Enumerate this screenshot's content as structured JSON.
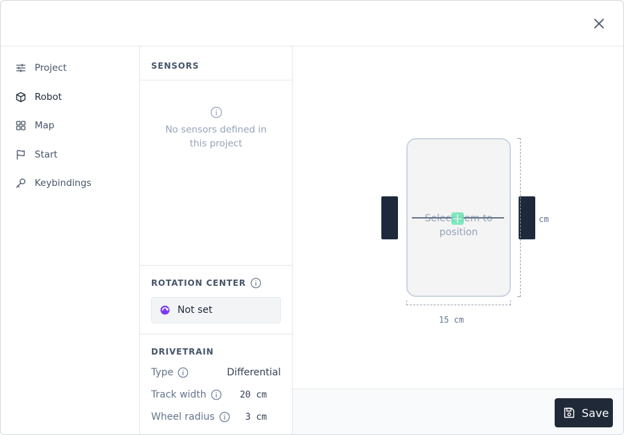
{
  "nav": {
    "items": [
      {
        "label": "Project",
        "icon": "sliders-icon"
      },
      {
        "label": "Robot",
        "icon": "cube-icon"
      },
      {
        "label": "Map",
        "icon": "grid-icon"
      },
      {
        "label": "Start",
        "icon": "flag-icon"
      },
      {
        "label": "Keybindings",
        "icon": "key-icon"
      }
    ],
    "active": "Robot"
  },
  "sensors": {
    "title": "SENSORS",
    "empty_text": "No sensors defined in this project"
  },
  "rotation_center": {
    "title": "ROTATION CENTER",
    "value": "Not set"
  },
  "drivetrain": {
    "title": "DRIVETRAIN",
    "type_label": "Type",
    "type_value": "Differential",
    "track_width_label": "Track width",
    "track_width_value": "20 cm",
    "wheel_radius_label": "Wheel radius",
    "wheel_radius_value": "3 cm"
  },
  "canvas": {
    "placeholder": "Select item to position",
    "height_label": "cm",
    "width_label": "15 cm"
  },
  "footer": {
    "save_label": "Save"
  },
  "colors": {
    "save_button": "#1f2937",
    "wheel": "#1e293b",
    "center_marker": "#6ee7b7",
    "rotation_icon": "#7c3aed"
  }
}
